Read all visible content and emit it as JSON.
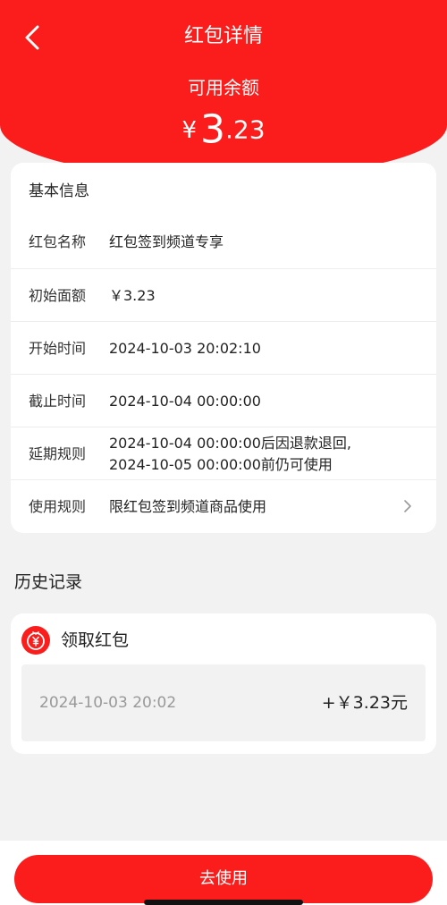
{
  "header": {
    "title": "红包详情",
    "balance_label": "可用余额",
    "currency": "¥",
    "balance_int": "3",
    "balance_dec": ".23"
  },
  "info": {
    "title": "基本信息",
    "rows": [
      {
        "label": "红包名称",
        "value": "红包签到频道专享"
      },
      {
        "label": "初始面额",
        "value": "￥3.23"
      },
      {
        "label": "开始时间",
        "value": "2024-10-03 20:02:10"
      },
      {
        "label": "截止时间",
        "value": "2024-10-04 00:00:00"
      },
      {
        "label": "延期规则",
        "value_line1": "2024-10-04 00:00:00后因退款退回,",
        "value_line2": "2024-10-05 00:00:00前仍可使用"
      },
      {
        "label": "使用规则",
        "value": "限红包签到频道商品使用"
      }
    ]
  },
  "history": {
    "title": "历史记录",
    "type_label": "领取红包",
    "records": [
      {
        "time": "2024-10-03 20:02",
        "amount": "+￥3.23元"
      }
    ]
  },
  "footer": {
    "button_label": "去使用"
  },
  "colors": {
    "brand_red": "#fb1d1c",
    "background": "#f2f2f2"
  },
  "icons": [
    "chevron-left-icon",
    "chevron-right-icon",
    "red-envelope-yen-icon"
  ]
}
